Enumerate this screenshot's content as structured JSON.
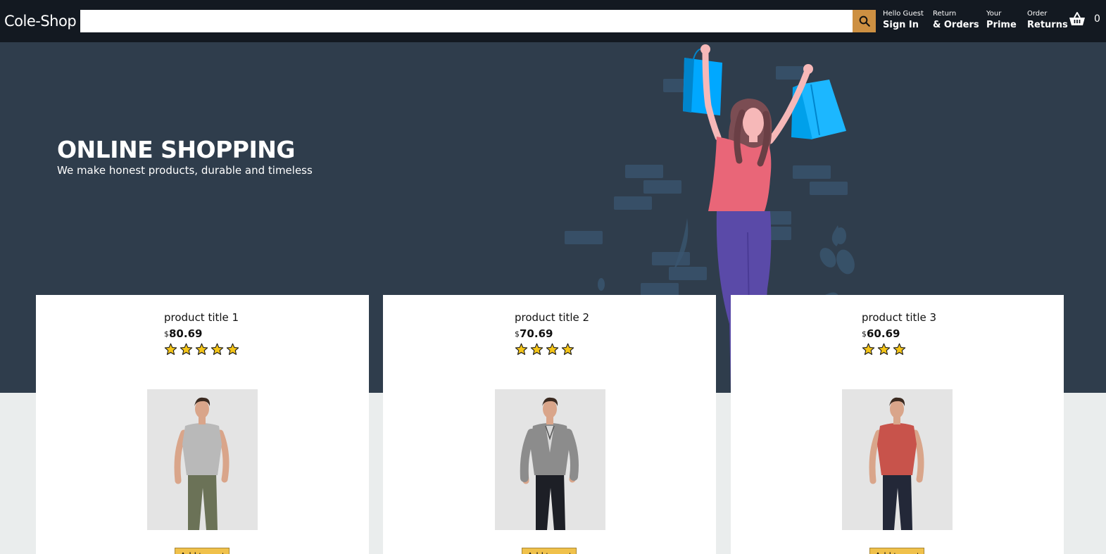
{
  "header": {
    "logo": "Cole-Shop",
    "search": {
      "value": "",
      "placeholder": ""
    },
    "nav": [
      {
        "line1": "Hello Guest",
        "line2": "Sign In"
      },
      {
        "line1": "Return",
        "line2": "& Orders"
      },
      {
        "line1": "Your",
        "line2": "Prime"
      },
      {
        "line1": "Order",
        "line2": "Returns"
      }
    ],
    "basket_count": "0",
    "icons": {
      "search": "search-icon",
      "basket": "basket-icon"
    },
    "colors": {
      "bar": "#131921",
      "search_button": "#cd9042"
    }
  },
  "hero": {
    "title": "ONLINE SHOPPING",
    "subtitle": "We make honest products, durable and timeless",
    "background": "#2f3d4c"
  },
  "products": [
    {
      "title": "product title 1",
      "currency": "$",
      "price": "80.69",
      "rating": 5,
      "button": "Add to cart",
      "shirt_color": "#b9b9b9",
      "pants_color": "#6b7257",
      "jacket": false
    },
    {
      "title": "product title 2",
      "currency": "$",
      "price": "70.69",
      "rating": 4,
      "button": "Add to cart",
      "shirt_color": "#8c8c8c",
      "pants_color": "#1d1f26",
      "jacket": true
    },
    {
      "title": "product title 3",
      "currency": "$",
      "price": "60.69",
      "rating": 3,
      "button": "Add to cart",
      "shirt_color": "#c8534b",
      "pants_color": "#232838",
      "jacket": false
    }
  ],
  "colors": {
    "star": "#f5c518",
    "button": "#f0c14b"
  }
}
